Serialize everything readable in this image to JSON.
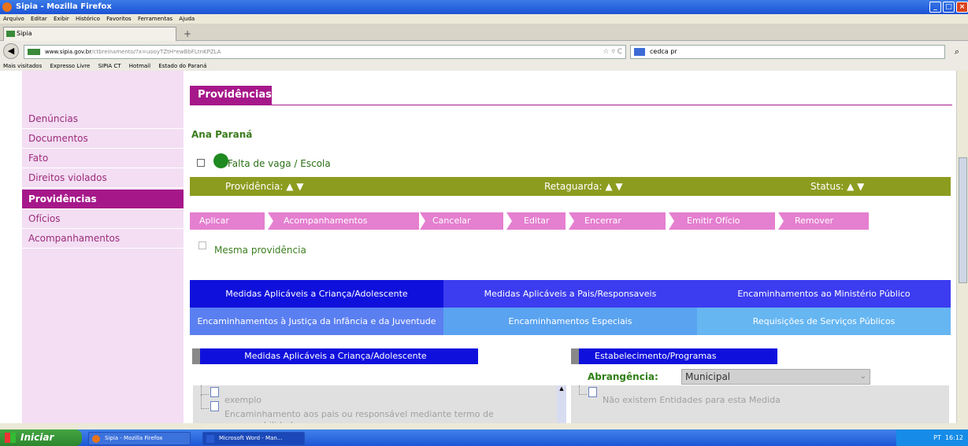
{
  "window": {
    "title": "Sipia - Mozilla Firefox"
  },
  "menubar": [
    "Arquivo",
    "Editar",
    "Exibir",
    "Histórico",
    "Favoritos",
    "Ferramentas",
    "Ajuda"
  ],
  "browser_tab": {
    "title": "Sipia"
  },
  "address": {
    "domain": "www.sipia.gov.br",
    "path": "/ctbreinamento/?x=uooyTZtH*ewBbFLtnKPZLA"
  },
  "search": {
    "value": "cedca pr"
  },
  "bookmarks": [
    "Mais visitados",
    "Expresso Livre",
    "SIPIA CT",
    "Hotmail",
    "Estado do Paraná"
  ],
  "sidebar": {
    "items": [
      {
        "label": "Denúncias",
        "active": false
      },
      {
        "label": "Documentos",
        "active": false
      },
      {
        "label": "Fato",
        "active": false
      },
      {
        "label": "Direitos violados",
        "active": false
      },
      {
        "label": "Providências",
        "active": true
      },
      {
        "label": "Ofícios",
        "active": false
      },
      {
        "label": "Acompanhamentos",
        "active": false
      }
    ]
  },
  "main": {
    "heading": "Providências",
    "person": "Ana Paraná",
    "problem": "Falta de vaga / Escola",
    "columns": {
      "providencia": "Providência:",
      "retaguarda": "Retaguarda:",
      "status": "Status:"
    },
    "sort_icons": "▲ ▼",
    "actions": [
      "Aplicar",
      "Acompanhamentos",
      "Cancelar",
      "Editar",
      "Encerrar",
      "Emitir Ofício",
      "Remover"
    ],
    "same_providence": "Mesma providência",
    "measure_tabs": [
      {
        "label": "Medidas Aplicáveis a Criança/Adolescente",
        "color": "#1010dd"
      },
      {
        "label": "Medidas Aplicáveis a Pais/Responsaveis",
        "color": "#3c3cf0"
      },
      {
        "label": "Encaminhamentos ao Ministério Público",
        "color": "#3c3cf0"
      },
      {
        "label": "Encaminhamentos à Justiça da Infância e da Juventude",
        "color": "#5a7ff0"
      },
      {
        "label": "Encaminhamentos Especiais",
        "color": "#5aa3f0"
      },
      {
        "label": "Requisições de Serviços Públicos",
        "color": "#66b6f2"
      }
    ],
    "left_panel": {
      "title": "Medidas Aplicáveis a Criança/Adolescente",
      "items": [
        "exemplo",
        "Encaminhamento aos pais ou responsável mediante termo de responsabilidade"
      ]
    },
    "right_panel": {
      "title": "Estabelecimento/Programas",
      "abrangencia_label": "Abrangência:",
      "abrangencia_value": "Municipal",
      "empty_text": "Não existem Entidades para esta Medida"
    }
  },
  "taskbar": {
    "start": "Iniciar",
    "items": [
      "Sipia - Mozilla Firefox",
      "Microsoft Word - Man..."
    ],
    "lang": "PT",
    "clock": "16:12"
  },
  "colors": {
    "brand": "#a6188a",
    "green_bar": "#8c9c1f",
    "action": "#e57fd0",
    "tab_blue": "#1010dd"
  }
}
